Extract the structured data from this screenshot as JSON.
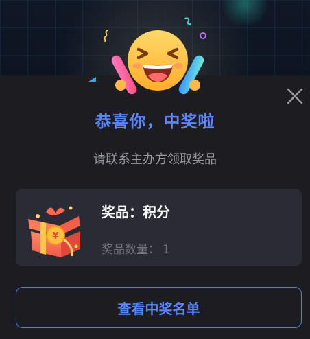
{
  "dialog": {
    "title": "恭喜你，中奖啦",
    "subtitle": "请联系主办方领取奖品",
    "close_icon": "close-icon",
    "emoji_icon": "laughing-face-icon"
  },
  "prize": {
    "name_label": "奖品：积分",
    "quantity_label": "奖品数量：",
    "quantity_value": "1",
    "gift_icon": "gift-box-icon"
  },
  "actions": {
    "view_winners_label": "查看中奖名单"
  },
  "colors": {
    "accent": "#5b86ff",
    "panel_bg": "#1c1c21",
    "card_bg": "#2a2b34",
    "muted_text": "#9a9aa2"
  }
}
